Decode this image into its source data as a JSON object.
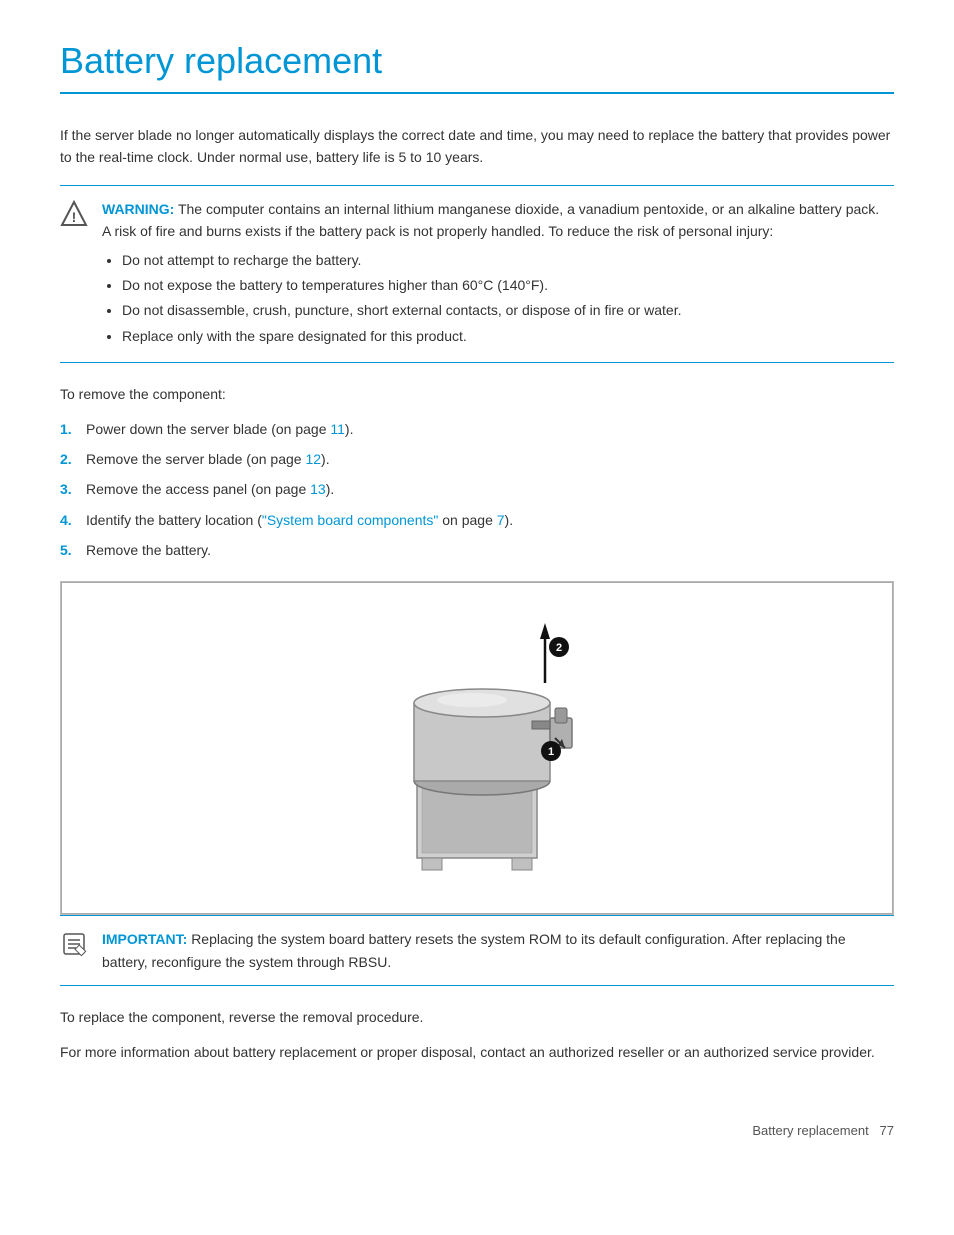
{
  "page": {
    "title": "Battery replacement",
    "intro": "If the server blade no longer automatically displays the correct date and time, you may need to replace the battery that provides power to the real-time clock. Under normal use, battery life is 5 to 10 years.",
    "warning": {
      "label": "WARNING:",
      "text": "The computer contains an internal lithium manganese dioxide, a vanadium pentoxide, or an alkaline battery pack. A risk of fire and burns exists if the battery pack is not properly handled. To reduce the risk of personal injury:",
      "bullets": [
        "Do not attempt to recharge the battery.",
        "Do not expose the battery to temperatures higher than 60°C (140°F).",
        "Do not disassemble, crush, puncture, short external contacts, or dispose of in fire or water.",
        "Replace only with the spare designated for this product."
      ]
    },
    "to_remove_label": "To remove the component:",
    "steps": [
      {
        "num": "1.",
        "text": "Power down the server blade (on page ",
        "link": "11",
        "suffix": ")."
      },
      {
        "num": "2.",
        "text": "Remove the server blade (on page ",
        "link": "12",
        "suffix": ")."
      },
      {
        "num": "3.",
        "text": "Remove the access panel (on page ",
        "link": "13",
        "suffix": ")."
      },
      {
        "num": "4.",
        "text": "Identify the battery location (\"",
        "link_text": "System board components",
        "link_href": "7",
        "suffix": "\" on page 7)."
      },
      {
        "num": "5.",
        "text": "Remove the battery.",
        "link": null,
        "suffix": ""
      }
    ],
    "important": {
      "label": "IMPORTANT:",
      "text": "Replacing the system board battery resets the system ROM to its default configuration. After replacing the battery, reconfigure the system through RBSU."
    },
    "replace_text": "To replace the component, reverse the removal procedure.",
    "more_info_text": "For more information about battery replacement or proper disposal, contact an authorized reseller or an authorized service provider.",
    "footer": {
      "text": "Battery replacement",
      "page_num": "77"
    }
  }
}
